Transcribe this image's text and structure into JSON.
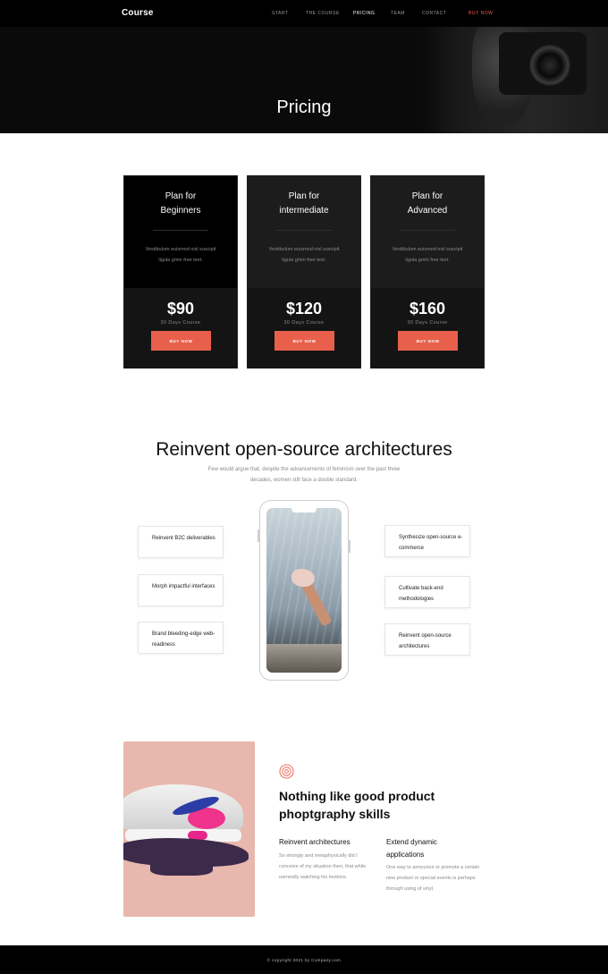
{
  "header": {
    "logo": "Course",
    "nav": [
      {
        "label": "START"
      },
      {
        "label": "THE COURSE"
      },
      {
        "label": "PRICING"
      },
      {
        "label": "TEAM"
      },
      {
        "label": "CONTACT"
      },
      {
        "label": "BUY NOW"
      }
    ],
    "active": "PRICING",
    "accent_color": "#e8604c"
  },
  "hero": {
    "title": "Pricing"
  },
  "pricing": {
    "plans": [
      {
        "name_line1": "Plan for",
        "name_line2": "Beginners",
        "description": "Vestibulum euismod nisl suscipit ligula gmin free text.",
        "price": "$90",
        "duration": "30 Days Course",
        "button": "BUY NOW"
      },
      {
        "name_line1": "Plan for",
        "name_line2": "intermediate",
        "description": "Vestibulum euismod nisl suscipit ligula gmin free text.",
        "price": "$120",
        "duration": "30 Days Course",
        "button": "BUY NOW"
      },
      {
        "name_line1": "Plan for",
        "name_line2": "Advanced",
        "description": "Vestibulum euismod nisl suscipit ligula gmin free text.",
        "price": "$160",
        "duration": "30 Days Course",
        "button": "BUY NOW"
      }
    ]
  },
  "features": {
    "title": "Reinvent open-source architectures",
    "subtitle": "Few would argue that, despite the advancements of feminism over the past three decades, women still face a double standard.",
    "left": [
      "Reinvent B2C deliverables",
      "Morph impactful interfaces",
      "Brand bleeding-edge web-readiness"
    ],
    "right": [
      "Synthesize open-source e-commerce",
      "Cultivate back-end methodologies",
      "Reinvent open-source architectures"
    ]
  },
  "product": {
    "icon": "target-icon",
    "title": "Nothing like good product phoptgraphy skills",
    "col1": {
      "title": "Reinvent architectures",
      "text": "So strongly and metaphysically did I conceive of my situation then, that while earnestly watching his motions."
    },
    "col2": {
      "title": "Extend dynamic applications",
      "text": "One way to announce or promote a certain new product or special events is perhaps through using of vinyl."
    }
  },
  "footer": {
    "text": "© copyright 2021 by Company.com"
  }
}
